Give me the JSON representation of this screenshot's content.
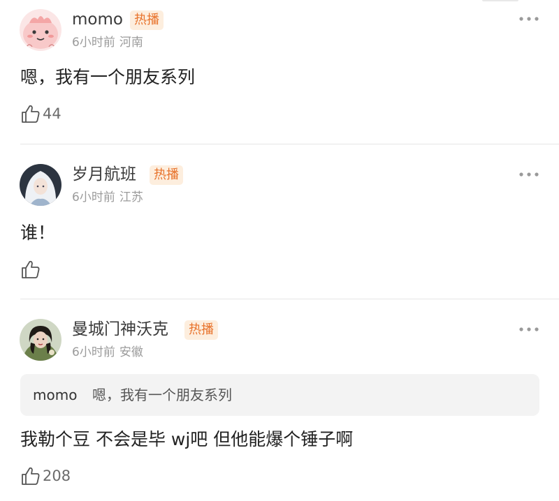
{
  "comments": [
    {
      "username": "momo",
      "badge": "热播",
      "time": "6小时前",
      "location": "河南",
      "text": "嗯，我有一个朋友系列",
      "likes": "44"
    },
    {
      "username": "岁月航班",
      "badge": "热播",
      "time": "6小时前",
      "location": "江苏",
      "text": "谁！",
      "likes": ""
    },
    {
      "username": "曼城门神沃克",
      "badge": "热播",
      "time": "6小时前",
      "location": "安徽",
      "quote": {
        "username": "momo",
        "text": "嗯，我有一个朋友系列"
      },
      "text": "我勒个豆 不会是毕 wj吧 但他能爆个锤子啊",
      "likes": "208"
    }
  ],
  "colors": {
    "badge_text": "#e8732c",
    "badge_bg": "#fdeede",
    "meta_text": "#9b9b9b",
    "quote_bg": "#f3f3f3"
  },
  "icons": {
    "like": "thumbs-up-icon",
    "more": "more-dots-icon"
  }
}
